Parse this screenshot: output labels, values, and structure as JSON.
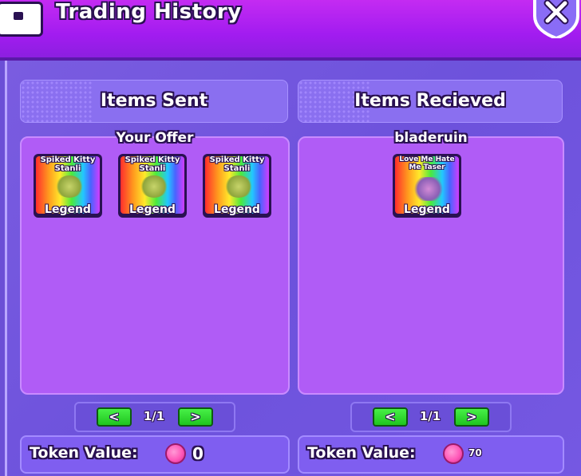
{
  "header": {
    "title": "Trading History"
  },
  "sent": {
    "heading": "Items Sent",
    "box_title": "Your Offer",
    "items": [
      {
        "name": "Spiked Kitty Stanli",
        "rarity": "Legend"
      },
      {
        "name": "Spiked Kitty Stanli",
        "rarity": "Legend"
      },
      {
        "name": "Spiked Kitty Stanli",
        "rarity": "Legend"
      }
    ],
    "pager": {
      "prev": "<",
      "page": "1/1",
      "next": ">"
    },
    "token_label": "Token Value:",
    "token_value": "0"
  },
  "received": {
    "heading": "Items Recieved",
    "box_title": "bladeruin",
    "items": [
      {
        "name": "Love Me Hate Me Taser",
        "rarity": "Legend"
      }
    ],
    "pager": {
      "prev": "<",
      "page": "1/1",
      "next": ">"
    },
    "token_label": "Token Value:",
    "token_value": "70"
  },
  "icons": {
    "header_icon": "chest-icon",
    "close_icon": "close-icon",
    "token_icon": "token-coin-icon"
  }
}
